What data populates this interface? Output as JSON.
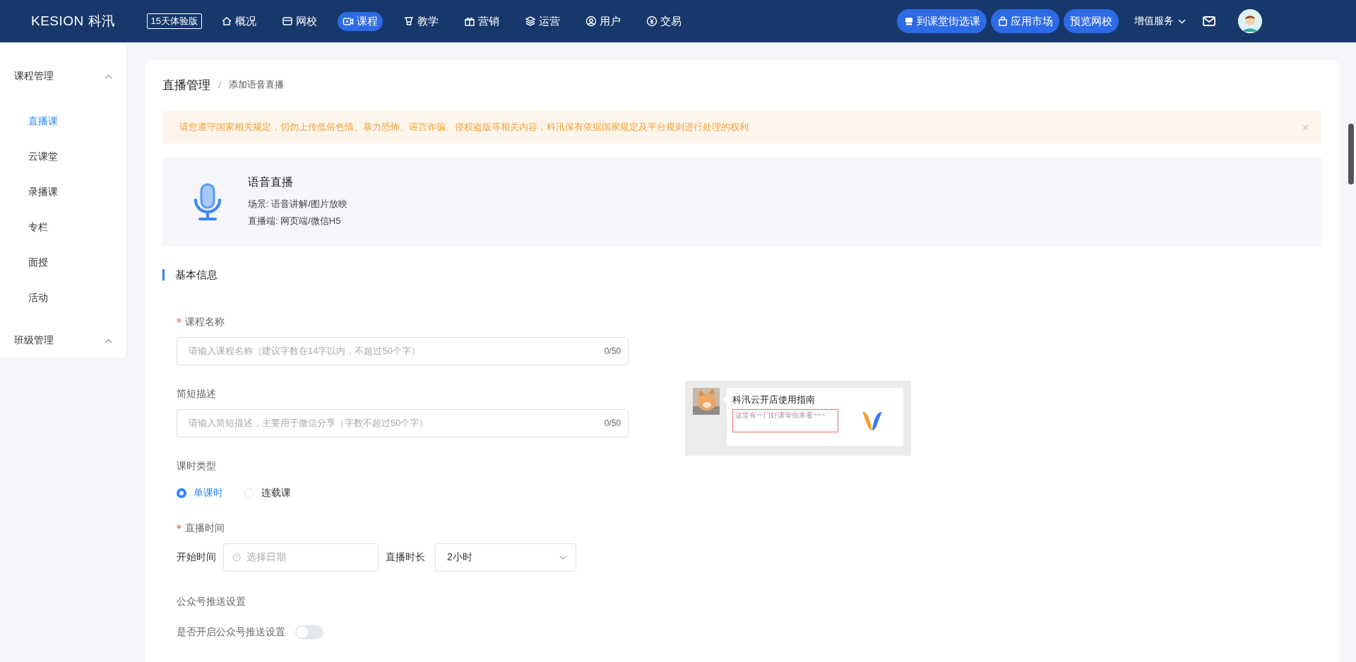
{
  "topbar": {
    "logo": "KESION 科汛",
    "trial_badge": "15天体验版",
    "nav": [
      {
        "label": "概况",
        "selected": false
      },
      {
        "label": "网校",
        "selected": false
      },
      {
        "label": "课程",
        "selected": true
      },
      {
        "label": "教学",
        "selected": false
      },
      {
        "label": "营销",
        "selected": false
      },
      {
        "label": "运营",
        "selected": false
      },
      {
        "label": "用户",
        "selected": false
      },
      {
        "label": "交易",
        "selected": false
      }
    ],
    "actions": [
      {
        "label": "到课堂街选课"
      },
      {
        "label": "应用市场"
      },
      {
        "label": "预览网校"
      }
    ],
    "service_menu": "增值服务"
  },
  "sidebar": [
    {
      "label": "课程管理",
      "expanded": true,
      "children": [
        {
          "label": "直播课",
          "selected": true
        },
        {
          "label": "云课堂",
          "selected": false
        },
        {
          "label": "录播课",
          "selected": false
        },
        {
          "label": "专栏",
          "selected": false
        },
        {
          "label": "面授",
          "selected": false
        },
        {
          "label": "活动",
          "selected": false
        }
      ]
    },
    {
      "label": "班级管理",
      "expanded": true
    }
  ],
  "breadcrumb": [
    "直播管理",
    "添加语音直播"
  ],
  "alert": "请您遵守国家相关规定，切勿上传低俗色情、暴力恐怖、谣言诈骗、侵权盗版等相关内容，科汛保有依据国家规定及平台规则进行处理的权利",
  "live_type": {
    "title": "语音直播",
    "scene": "场景: 语音讲解/图片放映",
    "client": "直播端: 网页端/微信H5"
  },
  "section_title": "基本信息",
  "form": {
    "course_name": {
      "label": "课程名称",
      "required": true,
      "placeholder": "请输入课程名称（建议字数在14字以内，不超过50个字）",
      "counter": "0/50"
    },
    "summary": {
      "label": "简短描述",
      "placeholder": "请输入简短描述，主要用于微信分享（字数不超过50个字）",
      "counter": "0/50"
    },
    "lesson_type": {
      "label": "课时类型",
      "options": [
        {
          "label": "单课时",
          "selected": true
        },
        {
          "label": "连载课",
          "selected": false
        }
      ]
    },
    "live_time": {
      "label": "直播时间",
      "required": true,
      "start_label": "开始时间",
      "start_placeholder": "选择日期",
      "duration_label": "直播时长",
      "duration_value": "2小时"
    },
    "push": {
      "label": "公众号推送设置",
      "toggle_label": "是否开启公众号推送设置",
      "on": false
    }
  },
  "share_preview": {
    "title": "科汛云开店使用指南",
    "desc": "这里有一门好课等你来看~~~"
  }
}
